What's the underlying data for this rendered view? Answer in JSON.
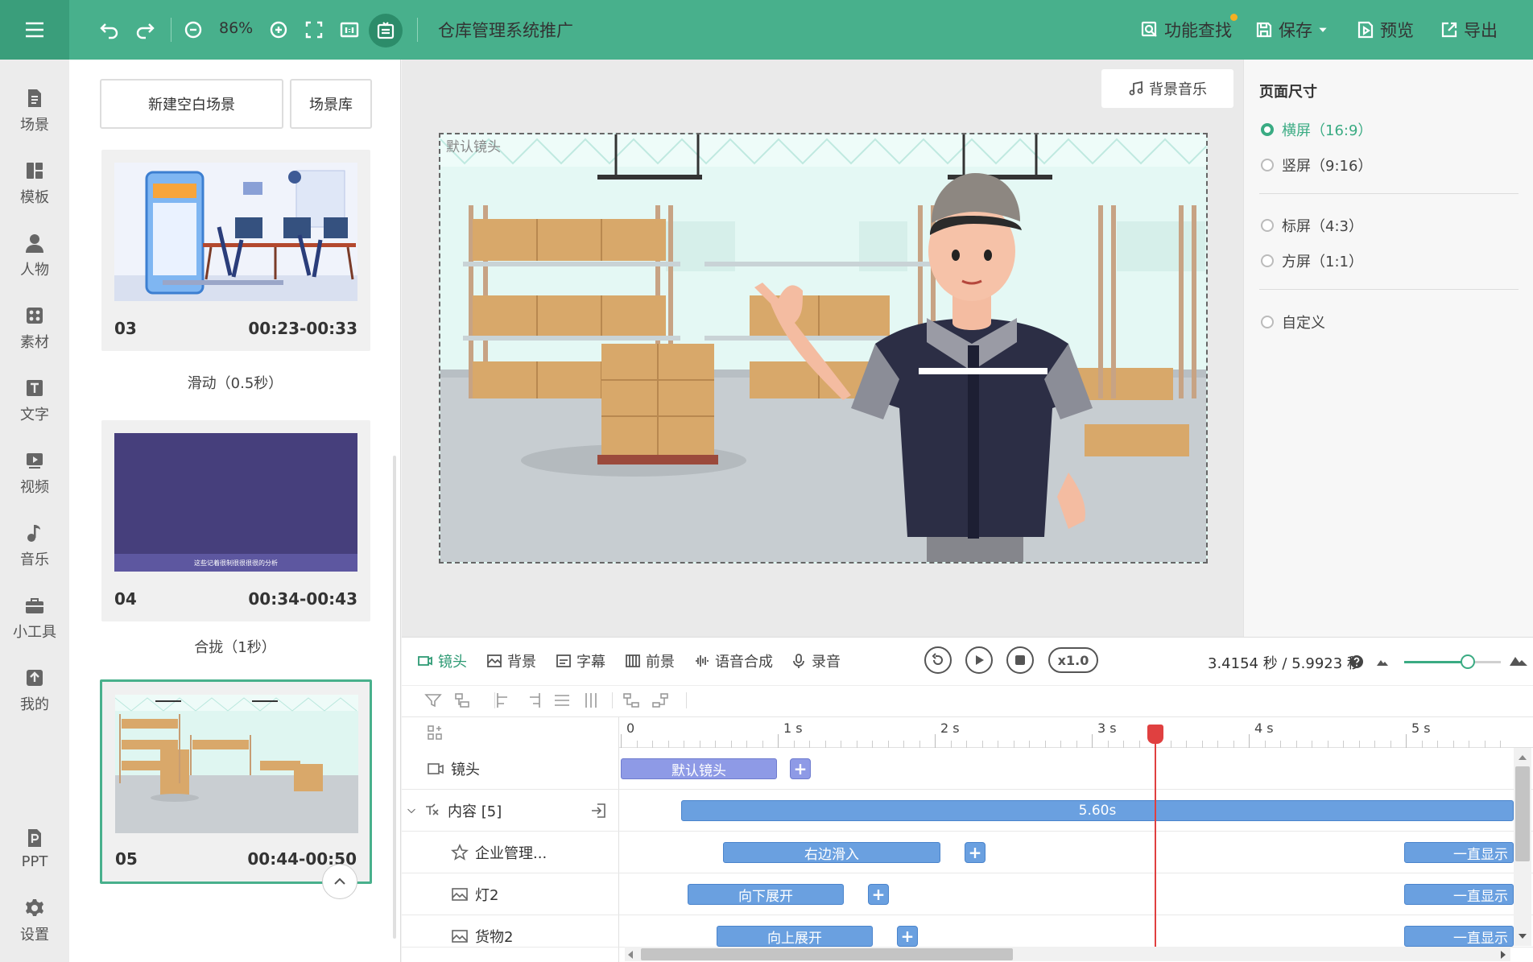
{
  "toolbar": {
    "zoom": "86%",
    "project_title": "仓库管理系统推广",
    "find_label": "功能查找",
    "save_label": "保存",
    "preview_label": "预览",
    "export_label": "导出"
  },
  "nav": {
    "items": [
      {
        "label": "场景"
      },
      {
        "label": "模板"
      },
      {
        "label": "人物"
      },
      {
        "label": "素材"
      },
      {
        "label": "文字"
      },
      {
        "label": "视频"
      },
      {
        "label": "音乐"
      },
      {
        "label": "小工具"
      },
      {
        "label": "我的"
      },
      {
        "label": "PPT"
      },
      {
        "label": "设置"
      }
    ]
  },
  "scenes": {
    "new_blank": "新建空白场景",
    "library": "场景库",
    "items": [
      {
        "num": "03",
        "time": "00:23-00:33"
      },
      {
        "num": "04",
        "time": "00:34-00:43",
        "caption": "这些记着很制很很很很的分析"
      },
      {
        "num": "05",
        "time": "00:44-00:50"
      }
    ],
    "transitions": [
      "滑动（0.5秒）",
      "合拢（1秒）"
    ]
  },
  "canvas": {
    "bgm_label": "背景音乐",
    "camera_label": "默认镜头"
  },
  "page_size": {
    "title": "页面尺寸",
    "options": [
      {
        "label": "横屏（16:9）",
        "selected": true
      },
      {
        "label": "竖屏（9:16）",
        "selected": false
      },
      {
        "label": "标屏（4:3）",
        "selected": false
      },
      {
        "label": "方屏（1:1）",
        "selected": false
      },
      {
        "label": "自定义",
        "selected": false
      }
    ]
  },
  "timeline": {
    "tabs": [
      {
        "label": "镜头"
      },
      {
        "label": "背景"
      },
      {
        "label": "字幕"
      },
      {
        "label": "前景"
      },
      {
        "label": "语音合成"
      },
      {
        "label": "录音"
      }
    ],
    "speed": "x1.0",
    "time_readout": "3.4154 秒 / 5.9923 秒",
    "ruler": [
      "0",
      "1 s",
      "2 s",
      "3 s",
      "4 s",
      "5 s"
    ],
    "rows": [
      {
        "label": "镜头"
      },
      {
        "label": "内容 [5]"
      },
      {
        "label": "企业管理..."
      },
      {
        "label": "灯2"
      },
      {
        "label": "货物2"
      }
    ],
    "clips": {
      "camera": "默认镜头",
      "content": "5.60s",
      "row3": "右边滑入",
      "row4": "向下展开",
      "row5": "向上展开",
      "always": "一直显示"
    },
    "colors": {
      "accent": "#48b08c",
      "clip": "#6aa0e0",
      "camera_clip": "#8e9ae6",
      "playhead": "#e04040"
    }
  }
}
